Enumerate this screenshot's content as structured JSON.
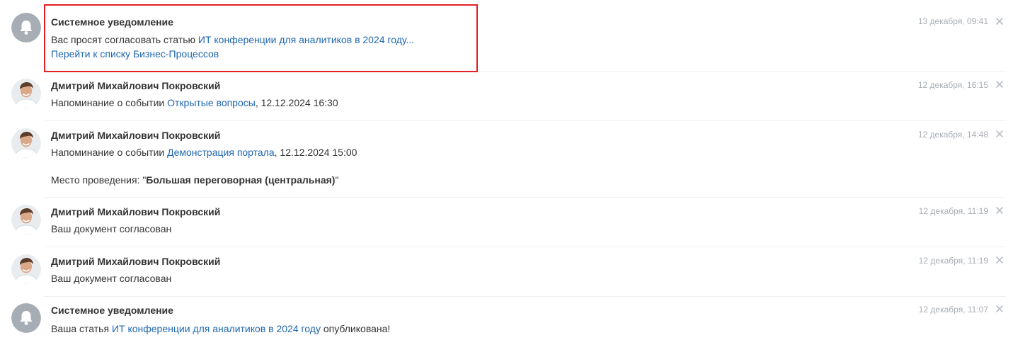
{
  "notifications": [
    {
      "type": "system",
      "author": "Системное уведомление",
      "date": "13 декабря, 09:41",
      "text_prefix": "Вас просят согласовать статью ",
      "link": "ИТ конференции для аналитиков в 2024 году...",
      "second_link": "Перейти к списку Бизнес-Процессов"
    },
    {
      "type": "user",
      "author": "Дмитрий Михайлович Покровский",
      "date": "12 декабря, 16:15",
      "text_prefix": "Напоминание о событии ",
      "link": "Открытые вопросы",
      "text_suffix": ", 12.12.2024 16:30"
    },
    {
      "type": "user",
      "author": "Дмитрий Михайлович Покровский",
      "date": "12 декабря, 14:48",
      "text_prefix": "Напоминание о событии ",
      "link": "Демонстрация портала",
      "text_suffix": ", 12.12.2024 15:00",
      "place_label": "Место проведения: \"",
      "place_value": "Большая переговорная (центральная)",
      "place_end": "\""
    },
    {
      "type": "user",
      "author": "Дмитрий Михайлович Покровский",
      "date": "12 декабря, 11:19",
      "text": "Ваш документ согласован"
    },
    {
      "type": "user",
      "author": "Дмитрий Михайлович Покровский",
      "date": "12 декабря, 11:19",
      "text": "Ваш документ согласован"
    },
    {
      "type": "system",
      "author": "Системное уведомление",
      "date": "12 декабря, 11:07",
      "text_prefix": "Ваша статья ",
      "link": "ИТ конференции для аналитиков в 2024 году",
      "text_suffix": " опубликована!"
    }
  ],
  "colors": {
    "link": "#2067b0",
    "highlight": "#e31e24",
    "date": "#a8adb4",
    "bell_bg": "#a6adb5"
  },
  "icons": {
    "system_avatar": "bell-icon",
    "user_avatar": "user-photo",
    "close": "close-icon"
  }
}
